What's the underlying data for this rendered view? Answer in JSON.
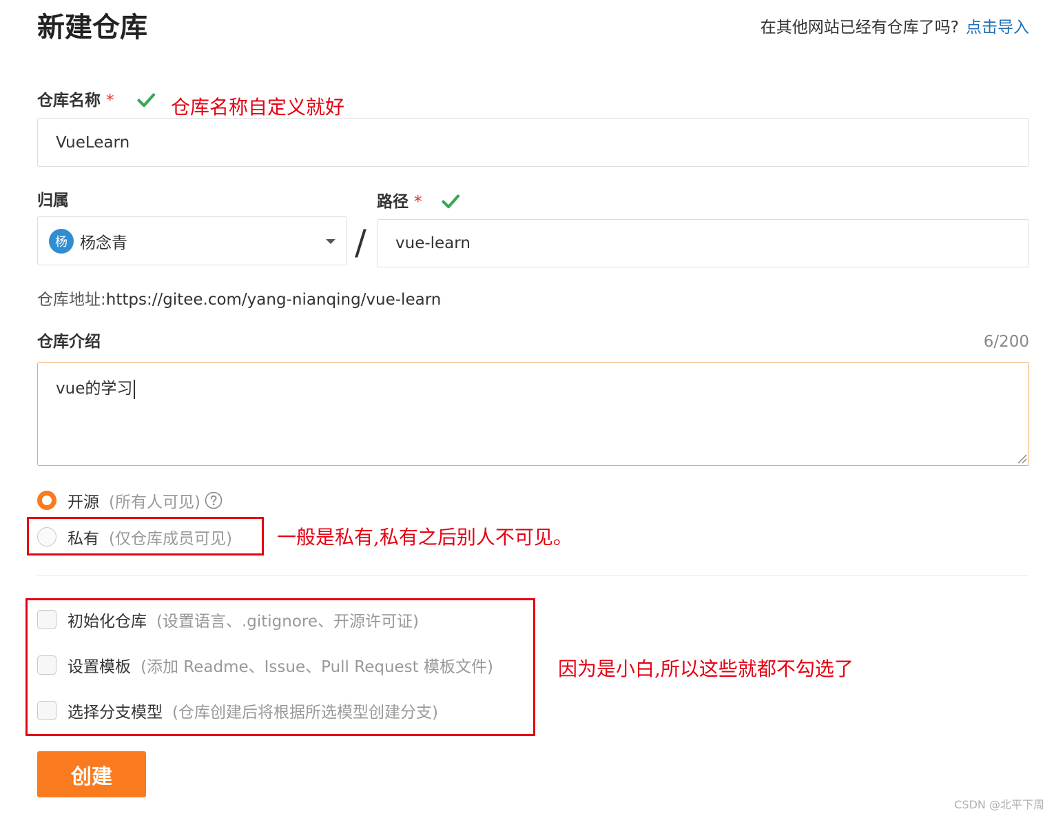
{
  "header": {
    "title": "新建仓库",
    "import_prompt": "在其他网站已经有仓库了吗?",
    "import_link": "点击导入"
  },
  "repo_name": {
    "label": "仓库名称",
    "required_mark": "*",
    "value": "VueLearn",
    "annotation": "仓库名称自定义就好"
  },
  "owner": {
    "label": "归属",
    "avatar_text": "杨",
    "name": "杨念青"
  },
  "separator": "/",
  "path": {
    "label": "路径",
    "required_mark": "*",
    "value": "vue-learn"
  },
  "repo_url": {
    "label": "仓库地址:",
    "value": "https://gitee.com/yang-nianqing/vue-learn"
  },
  "description": {
    "label": "仓库介绍",
    "counter": "6/200",
    "value": "vue的学习"
  },
  "visibility": {
    "public": {
      "label": "开源",
      "hint": "(所有人可见)",
      "selected": true
    },
    "private": {
      "label": "私有",
      "hint": "(仅仓库成员可见)",
      "selected": false
    },
    "annotation": "一般是私有,私有之后别人不可见。"
  },
  "options": {
    "items": [
      {
        "label": "初始化仓库",
        "hint": "(设置语言、.gitignore、开源许可证)",
        "checked": false
      },
      {
        "label": "设置模板",
        "hint": "(添加 Readme、Issue、Pull Request 模板文件)",
        "checked": false
      },
      {
        "label": "选择分支模型",
        "hint": "(仓库创建后将根据所选模型创建分支)",
        "checked": false
      }
    ],
    "annotation": "因为是小白,所以这些就都不勾选了"
  },
  "create_button": "创建",
  "watermark": "CSDN @北平下周",
  "colors": {
    "accent": "#fa7b1f",
    "link": "#1f6fb5",
    "success": "#3aa757",
    "annotation": "#e60012",
    "avatar": "#2f8dd1"
  }
}
